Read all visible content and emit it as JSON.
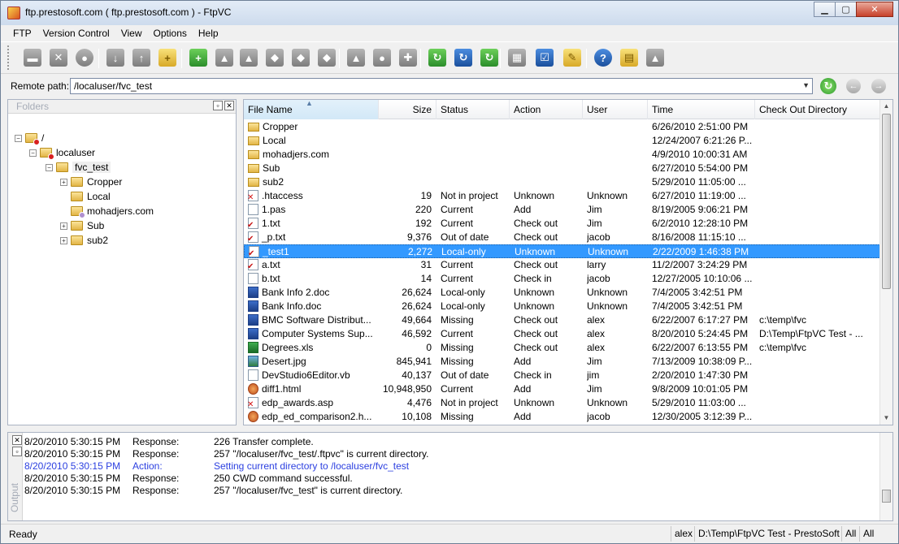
{
  "window": {
    "title": "ftp.prestosoft.com  ( ftp.prestosoft.com ) - FtpVC",
    "minimize": "▁",
    "maximize": "▢",
    "close": "✕"
  },
  "menu": [
    "FTP",
    "Version Control",
    "View",
    "Options",
    "Help"
  ],
  "toolbar": {
    "buttons": [
      {
        "icon": "disconnect-icon",
        "glyph": "▬",
        "color": "gray"
      },
      {
        "icon": "cancel-transfer-icon",
        "glyph": "✕",
        "color": "gray"
      },
      {
        "icon": "stop-icon",
        "glyph": "●",
        "color": "gray"
      },
      {
        "icon": "download-icon",
        "glyph": "↓",
        "color": "gray"
      },
      {
        "icon": "upload-icon",
        "glyph": "↑",
        "color": "gray"
      },
      {
        "icon": "new-folder-icon",
        "glyph": "+",
        "color": "yellow"
      },
      {
        "icon": "add-file-icon",
        "glyph": "+",
        "color": "green"
      },
      {
        "icon": "checkout-icon",
        "glyph": "▲",
        "color": "gray"
      },
      {
        "icon": "checkin-icon",
        "glyph": "▲",
        "color": "gray"
      },
      {
        "icon": "undo-checkout-icon",
        "glyph": "◆",
        "color": "gray"
      },
      {
        "icon": "get-latest-icon",
        "glyph": "◆",
        "color": "gray"
      },
      {
        "icon": "history-icon",
        "glyph": "◆",
        "color": "gray"
      },
      {
        "icon": "label-icon",
        "glyph": "▲",
        "color": "gray"
      },
      {
        "icon": "compare-icon",
        "glyph": "●",
        "color": "gray"
      },
      {
        "icon": "merge-icon",
        "glyph": "✚",
        "color": "gray"
      },
      {
        "icon": "sync-icon",
        "glyph": "↻",
        "color": "green"
      },
      {
        "icon": "refresh-status-icon",
        "glyph": "↻",
        "color": "blue"
      },
      {
        "icon": "refresh-icon",
        "glyph": "↻",
        "color": "green"
      },
      {
        "icon": "properties-icon",
        "glyph": "▦",
        "color": "gray"
      },
      {
        "icon": "project-settings-icon",
        "glyph": "☑",
        "color": "blue"
      },
      {
        "icon": "tools-icon",
        "glyph": "✎",
        "color": "yellow"
      },
      {
        "icon": "help-icon",
        "glyph": "?",
        "color": "blue"
      },
      {
        "icon": "folders-icon",
        "glyph": "▤",
        "color": "yellow"
      },
      {
        "icon": "misc-icon",
        "glyph": "▲",
        "color": "gray"
      }
    ]
  },
  "remote_path": {
    "label": "Remote path:",
    "value": "/localuser/fvc_test",
    "dropdown": "▼",
    "refresh": "↻",
    "back": "←",
    "forward": "→"
  },
  "folders_pane": {
    "title": "Folders",
    "pin": "▫",
    "close": "✕",
    "tree": [
      {
        "label": "/",
        "level": 0,
        "expander": "−",
        "overlay": "red"
      },
      {
        "label": "localuser",
        "level": 1,
        "expander": "−",
        "overlay": "red"
      },
      {
        "label": "fvc_test",
        "level": 2,
        "expander": "−",
        "overlay": "",
        "selected": true
      },
      {
        "label": "Cropper",
        "level": 3,
        "expander": "+",
        "overlay": ""
      },
      {
        "label": "Local",
        "level": 3,
        "expander": "",
        "overlay": ""
      },
      {
        "label": "mohadjers.com",
        "level": 3,
        "expander": "",
        "overlay": "purple"
      },
      {
        "label": "Sub",
        "level": 3,
        "expander": "+",
        "overlay": ""
      },
      {
        "label": "sub2",
        "level": 3,
        "expander": "+",
        "overlay": ""
      }
    ]
  },
  "file_list": {
    "columns": [
      "File Name",
      "Size",
      "Status",
      "Action",
      "User",
      "Time",
      "Check Out Directory"
    ],
    "sort_indicator": "▲",
    "rows": [
      {
        "icon": "folder",
        "mark": "",
        "name": "Cropper",
        "size": "",
        "status": "",
        "action": "",
        "user": "",
        "time": "6/26/2010 2:51:00 PM",
        "chk": ""
      },
      {
        "icon": "folder",
        "mark": "",
        "name": "Local",
        "size": "",
        "status": "",
        "action": "",
        "user": "",
        "time": "12/24/2007 6:21:26 P...",
        "chk": ""
      },
      {
        "icon": "folder",
        "mark": "",
        "name": "mohadjers.com",
        "size": "",
        "status": "",
        "action": "",
        "user": "",
        "time": "4/9/2010 10:00:31 AM",
        "chk": ""
      },
      {
        "icon": "folder",
        "mark": "",
        "name": "Sub",
        "size": "",
        "status": "",
        "action": "",
        "user": "",
        "time": "6/27/2010 5:54:00 PM",
        "chk": ""
      },
      {
        "icon": "folder",
        "mark": "",
        "name": "sub2",
        "size": "",
        "status": "",
        "action": "",
        "user": "",
        "time": "5/29/2010 11:05:00 ...",
        "chk": ""
      },
      {
        "icon": "file",
        "mark": "✕",
        "name": ".htaccess",
        "size": "19",
        "status": "Not in project",
        "action": "Unknown",
        "user": "Unknown",
        "time": "6/27/2010 11:19:00 ...",
        "chk": ""
      },
      {
        "icon": "file",
        "mark": "",
        "name": "1.pas",
        "size": "220",
        "status": "Current",
        "action": "Add",
        "user": "Jim",
        "time": "8/19/2005 9:06:21 PM",
        "chk": ""
      },
      {
        "icon": "file",
        "mark": "✔",
        "name": "1.txt",
        "size": "192",
        "status": "Current",
        "action": "Check out",
        "user": "Jim",
        "time": "6/2/2010 12:28:10 PM",
        "chk": ""
      },
      {
        "icon": "file",
        "mark": "✔",
        "name": "_p.txt",
        "size": "9,376",
        "status": "Out of date",
        "action": "Check out",
        "user": "jacob",
        "time": "8/16/2008 11:15:10 ...",
        "chk": ""
      },
      {
        "icon": "file",
        "mark": "✔",
        "name": "_test1",
        "size": "2,272",
        "status": "Local-only",
        "action": "Unknown",
        "user": "Unknown",
        "time": "2/22/2009 1:46:38 PM",
        "chk": "",
        "selected": true
      },
      {
        "icon": "file",
        "mark": "✔",
        "name": "a.txt",
        "size": "31",
        "status": "Current",
        "action": "Check out",
        "user": "larry",
        "time": "11/2/2007 3:24:29 PM",
        "chk": ""
      },
      {
        "icon": "file",
        "mark": "",
        "name": "b.txt",
        "size": "14",
        "status": "Current",
        "action": "Check in",
        "user": "jacob",
        "time": "12/27/2005 10:10:06 ...",
        "chk": ""
      },
      {
        "icon": "word",
        "mark": "",
        "name": "Bank Info 2.doc",
        "size": "26,624",
        "status": "Local-only",
        "action": "Unknown",
        "user": "Unknown",
        "time": "7/4/2005 3:42:51 PM",
        "chk": ""
      },
      {
        "icon": "word",
        "mark": "",
        "name": "Bank Info.doc",
        "size": "26,624",
        "status": "Local-only",
        "action": "Unknown",
        "user": "Unknown",
        "time": "7/4/2005 3:42:51 PM",
        "chk": ""
      },
      {
        "icon": "word",
        "mark": "",
        "name": "BMC Software Distribut...",
        "size": "49,664",
        "status": "Missing",
        "action": "Check out",
        "user": "alex",
        "time": "6/22/2007 6:17:27 PM",
        "chk": "c:\\temp\\fvc"
      },
      {
        "icon": "word",
        "mark": "",
        "name": "Computer Systems Sup...",
        "size": "46,592",
        "status": "Current",
        "action": "Check out",
        "user": "alex",
        "time": "8/20/2010 5:24:45 PM",
        "chk": "D:\\Temp\\FtpVC Test - ..."
      },
      {
        "icon": "excel",
        "mark": "",
        "name": "Degrees.xls",
        "size": "0",
        "status": "Missing",
        "action": "Check out",
        "user": "alex",
        "time": "6/22/2007 6:13:55 PM",
        "chk": "c:\\temp\\fvc"
      },
      {
        "icon": "image",
        "mark": "",
        "name": "Desert.jpg",
        "size": "845,941",
        "status": "Missing",
        "action": "Add",
        "user": "Jim",
        "time": "7/13/2009 10:38:09 P...",
        "chk": ""
      },
      {
        "icon": "file",
        "mark": "",
        "name": "DevStudio6Editor.vb",
        "size": "40,137",
        "status": "Out of date",
        "action": "Check in",
        "user": "jim",
        "time": "2/20/2010 1:47:30 PM",
        "chk": ""
      },
      {
        "icon": "web",
        "mark": "",
        "name": "diff1.html",
        "size": "10,948,950",
        "status": "Current",
        "action": "Add",
        "user": "Jim",
        "time": "9/8/2009 10:01:05 PM",
        "chk": ""
      },
      {
        "icon": "file",
        "mark": "✕",
        "name": "edp_awards.asp",
        "size": "4,476",
        "status": "Not in project",
        "action": "Unknown",
        "user": "Unknown",
        "time": "5/29/2010 11:03:00 ...",
        "chk": ""
      },
      {
        "icon": "web",
        "mark": "",
        "name": "edp_ed_comparison2.h...",
        "size": "10,108",
        "status": "Missing",
        "action": "Add",
        "user": "jacob",
        "time": "12/30/2005 3:12:39 P...",
        "chk": ""
      }
    ]
  },
  "output_pane": {
    "title": "Output",
    "close": "✕",
    "pin": "▫",
    "log": [
      {
        "time": "8/20/2010 5:30:15 PM",
        "type": "Response:",
        "message": "226 Transfer complete.",
        "kind": "response"
      },
      {
        "time": "8/20/2010 5:30:15 PM",
        "type": "Response:",
        "message": "257 \"/localuser/fvc_test/.ftpvc\" is current directory.",
        "kind": "response"
      },
      {
        "time": "8/20/2010 5:30:15 PM",
        "type": "Action:",
        "message": "Setting current directory to /localuser/fvc_test",
        "kind": "action"
      },
      {
        "time": "8/20/2010 5:30:15 PM",
        "type": "Response:",
        "message": "250 CWD command successful.",
        "kind": "response"
      },
      {
        "time": "8/20/2010 5:30:15 PM",
        "type": "Response:",
        "message": "257 \"/localuser/fvc_test\" is current directory.",
        "kind": "response"
      }
    ]
  },
  "statusbar": {
    "ready": "Ready",
    "user": "alex",
    "project": "D:\\Temp\\FtpVC Test - PrestoSoft",
    "filter1": "All",
    "filter2": "All"
  }
}
